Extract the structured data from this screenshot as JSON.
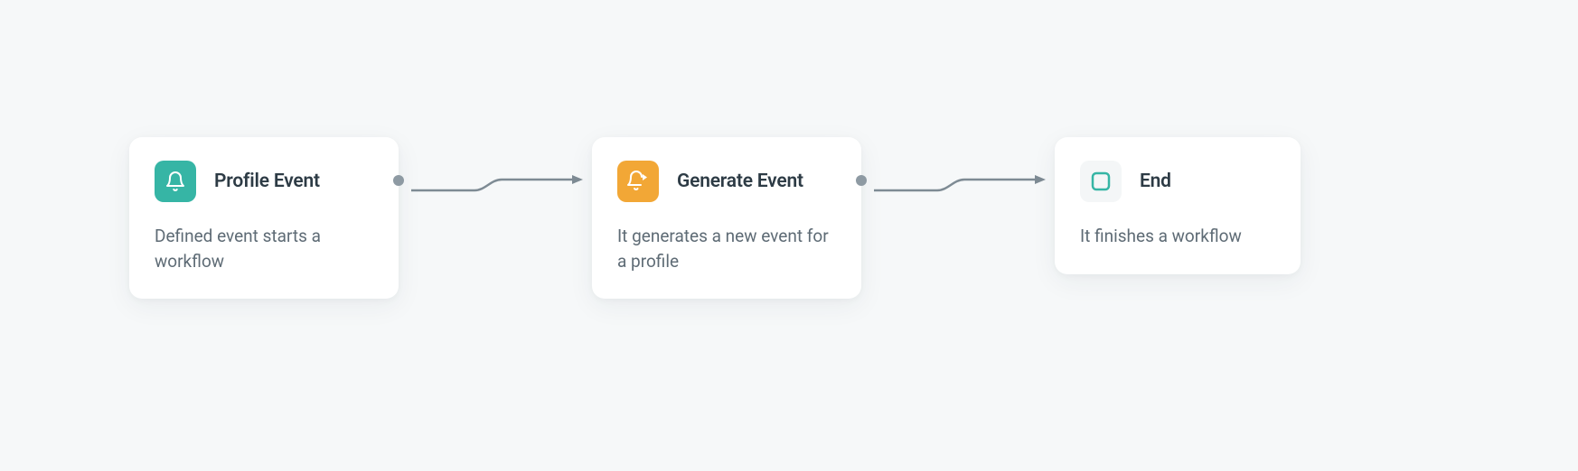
{
  "nodes": {
    "profile_event": {
      "title": "Profile Event",
      "description": "Defined event starts a workflow",
      "icon": "bell-icon",
      "icon_bg": "teal"
    },
    "generate_event": {
      "title": "Generate Event",
      "description": "It generates a new event for a profile",
      "icon": "bell-arrow-icon",
      "icon_bg": "orange"
    },
    "end": {
      "title": "End",
      "description": "It finishes a workflow",
      "icon": "stop-icon",
      "icon_bg": "gray"
    }
  }
}
